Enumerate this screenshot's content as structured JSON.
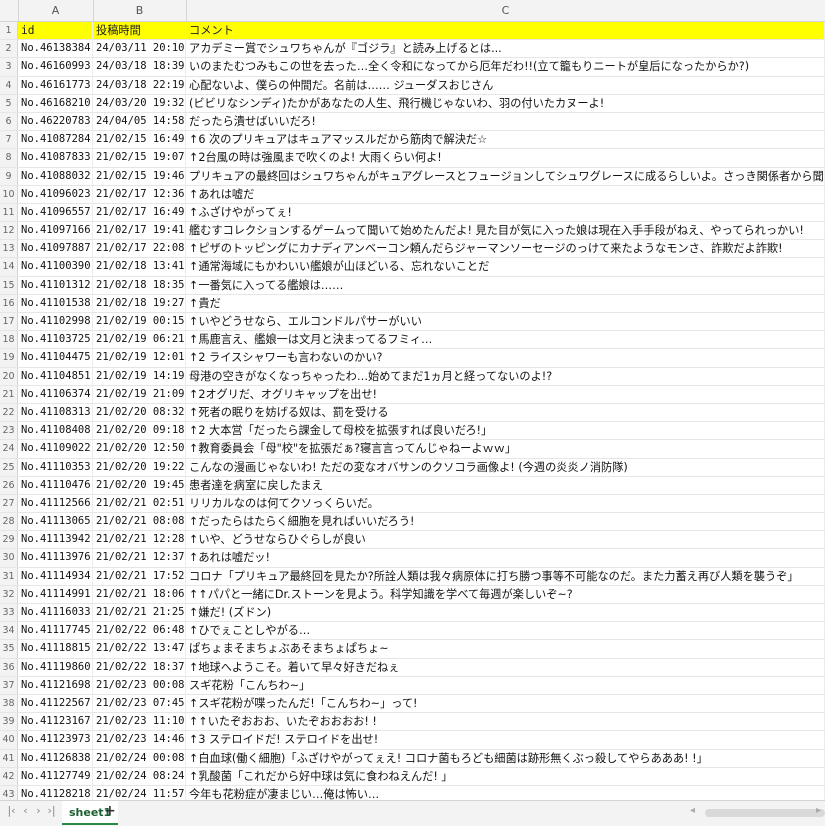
{
  "columns": [
    "A",
    "B",
    "C"
  ],
  "header_row": {
    "num": "1",
    "a": "id",
    "b": "投稿時間",
    "c": "コメント"
  },
  "rows": [
    {
      "num": "2",
      "a": "No.46138384",
      "b": "24/03/11 20:10",
      "c": "アカデミー賞でシュワちゃんが『ゴジラ』と読み上げるとは..."
    },
    {
      "num": "3",
      "a": "No.46160993",
      "b": "24/03/18 18:39",
      "c": "いのまたむつみもこの世を去った…全く令和になってから厄年だわ!!(立て籠もりニートが皇后になったからか?)"
    },
    {
      "num": "4",
      "a": "No.46161773",
      "b": "24/03/18 22:19",
      "c": "心配ないよ、僕らの仲間だ。名前は…… ジューダスおじさん"
    },
    {
      "num": "5",
      "a": "No.46168210",
      "b": "24/03/20 19:32",
      "c": "(ビビリなシンディ)たかがあなたの人生、飛行機じゃないわ、羽の付いたカヌーよ!"
    },
    {
      "num": "6",
      "a": "No.46220783",
      "b": "24/04/05 14:58",
      "c": "だったら潰せばいいだろ!"
    },
    {
      "num": "7",
      "a": "No.41087284",
      "b": "21/02/15 16:49",
      "c": "↑6 次のプリキュアはキュアマッスルだから筋肉で解決だ☆"
    },
    {
      "num": "8",
      "a": "No.41087833",
      "b": "21/02/15 19:07",
      "c": "↑2台風の時は強風まで吹くのよ! 大雨くらい何よ!"
    },
    {
      "num": "9",
      "a": "No.41088032",
      "b": "21/02/15 19:46",
      "c": "プリキュアの最終回はシュワちゃんがキュアグレースとフュージョンしてシュワグレースに成るらしいよ。さっき関係者から聞いた"
    },
    {
      "num": "10",
      "a": "No.41096023",
      "b": "21/02/17 12:36",
      "c": "↑あれは嘘だ"
    },
    {
      "num": "11",
      "a": "No.41096557",
      "b": "21/02/17 16:49",
      "c": "↑ふざけやがってぇ!"
    },
    {
      "num": "12",
      "a": "No.41097166",
      "b": "21/02/17 19:41",
      "c": "艦むすコレクションするゲームって聞いて始めたんだよ! 見た目が気に入った娘は現在入手手段がねえ、やってられっかい!"
    },
    {
      "num": "13",
      "a": "No.41097887",
      "b": "21/02/17 22:08",
      "c": "↑ピザのトッピングにカナディアンベーコン頼んだらジャーマンソーセージのっけて来たようなモンさ、詐欺だよ詐欺!"
    },
    {
      "num": "14",
      "a": "No.41100390",
      "b": "21/02/18 13:41",
      "c": "↑通常海域にもかわいい艦娘が山ほどいる、忘れないことだ"
    },
    {
      "num": "15",
      "a": "No.41101312",
      "b": "21/02/18 18:35",
      "c": "↑一番気に入ってる艦娘は……"
    },
    {
      "num": "16",
      "a": "No.41101538",
      "b": "21/02/18 19:27",
      "c": "↑貴だ"
    },
    {
      "num": "17",
      "a": "No.41102998",
      "b": "21/02/19 00:15",
      "c": "↑いやどうせなら、エルコンドルパサーがいい"
    },
    {
      "num": "18",
      "a": "No.41103725",
      "b": "21/02/19 06:21",
      "c": "↑馬鹿言え、艦娘一は文月と決まってるフミィ…"
    },
    {
      "num": "19",
      "a": "No.41104475",
      "b": "21/02/19 12:01",
      "c": "↑2 ライスシャワーも言わないのかい?"
    },
    {
      "num": "20",
      "a": "No.41104851",
      "b": "21/02/19 14:19",
      "c": "母港の空きがなくなっちゃったわ…始めてまだ1ヵ月と経ってないのよ!?"
    },
    {
      "num": "21",
      "a": "No.41106374",
      "b": "21/02/19 21:09",
      "c": "↑2オグリだ、オグリキャップを出せ!"
    },
    {
      "num": "22",
      "a": "No.41108313",
      "b": "21/02/20 08:32",
      "c": "↑死者の眠りを妨げる奴は、罰を受ける"
    },
    {
      "num": "23",
      "a": "No.41108408",
      "b": "21/02/20 09:18",
      "c": "↑2 大本営「だったら課金して母校を拡張すれば良いだろ!」"
    },
    {
      "num": "24",
      "a": "No.41109022",
      "b": "21/02/20 12:50",
      "c": "↑教育委員会「母\"校\"を拡張だぁ?寝言言ってんじゃねーよｗｗ」"
    },
    {
      "num": "25",
      "a": "No.41110353",
      "b": "21/02/20 19:22",
      "c": "こんなの漫画じゃないわ! ただの変なオバサンのクソコラ画像よ! (今週の炎炎ノ消防隊)"
    },
    {
      "num": "26",
      "a": "No.41110476",
      "b": "21/02/20 19:45",
      "c": "患者達を病室に戻したまえ"
    },
    {
      "num": "27",
      "a": "No.41112566",
      "b": "21/02/21 02:51",
      "c": "リリカルなのは何てクソっくらいだ。"
    },
    {
      "num": "28",
      "a": "No.41113065",
      "b": "21/02/21 08:08",
      "c": "↑だったらはたらく細胞を見ればいいだろう!"
    },
    {
      "num": "29",
      "a": "No.41113942",
      "b": "21/02/21 12:28",
      "c": "↑いや、どうせならひぐらしが良い"
    },
    {
      "num": "30",
      "a": "No.41113976",
      "b": "21/02/21 12:37",
      "c": "↑あれは嘘だッ!"
    },
    {
      "num": "31",
      "a": "No.41114934",
      "b": "21/02/21 17:52",
      "c": "コロナ「プリキュア最終回を見たか?所詮人類は我々病原体に打ち勝つ事等不可能なのだ。また力蓄え再び人類を襲うぞ」"
    },
    {
      "num": "32",
      "a": "No.41114991",
      "b": "21/02/21 18:06",
      "c": "↑↑パパと一緒にDr.ストーンを見よう。科学知識を学べて毎週が楽しいぞ~?"
    },
    {
      "num": "33",
      "a": "No.41116033",
      "b": "21/02/21 21:25",
      "c": "↑嫌だ! (ズドン)"
    },
    {
      "num": "34",
      "a": "No.41117745",
      "b": "21/02/22 06:48",
      "c": "↑ひでぇことしやがる…"
    },
    {
      "num": "35",
      "a": "No.41118815",
      "b": "21/02/22 13:47",
      "c": "ぱちょまそまちょぶあそまちょぱちょ~"
    },
    {
      "num": "36",
      "a": "No.41119860",
      "b": "21/02/22 18:37",
      "c": "↑地球へようこそ。着いて早々好きだねぇ"
    },
    {
      "num": "37",
      "a": "No.41121698",
      "b": "21/02/23 00:08",
      "c": "スギ花粉「こんちわ~」"
    },
    {
      "num": "38",
      "a": "No.41122567",
      "b": "21/02/23 07:45",
      "c": "↑スギ花粉が喋ったんだ!「こんちわ~」って!"
    },
    {
      "num": "39",
      "a": "No.41123167",
      "b": "21/02/23 11:10",
      "c": "↑↑いたぞおおお、いたぞおおおお! !"
    },
    {
      "num": "40",
      "a": "No.41123973",
      "b": "21/02/23 14:46",
      "c": "↑3 ステロイドだ! ステロイドを出せ!"
    },
    {
      "num": "41",
      "a": "No.41126838",
      "b": "21/02/24 00:08",
      "c": "↑白血球(働く細胞)「ふざけやがってぇえ! コロナ菌もろども細菌は跡形無くぶっ殺してやらあああ! !」"
    },
    {
      "num": "42",
      "a": "No.41127749",
      "b": "21/02/24 08:24",
      "c": "↑乳酸菌「これだから好中球は気に食わねえんだ! 」"
    },
    {
      "num": "43",
      "a": "No.41128218",
      "b": "21/02/24 11:57",
      "c": "今年も花粉症が凄まじい…俺は怖い…"
    }
  ],
  "sheet_tabs": [
    {
      "label": "sheet1"
    }
  ],
  "tab_bar": {
    "nav_first": "|‹",
    "nav_prev": "‹",
    "nav_next": "›",
    "nav_last": "›|",
    "add_tab": "+"
  },
  "colors": {
    "header_highlight": "#ffff00",
    "tab_accent": "#2a8a43"
  }
}
